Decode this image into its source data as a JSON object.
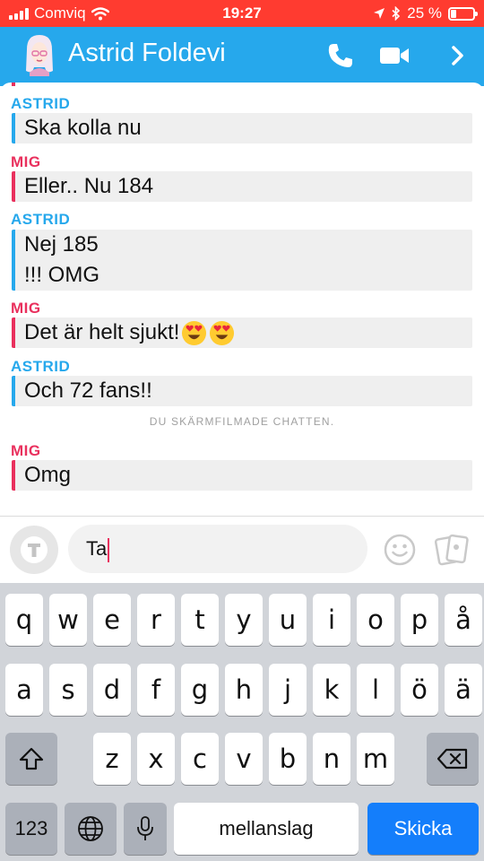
{
  "status_bar": {
    "carrier": "Comviq",
    "time": "19:27",
    "battery": "25 %",
    "battery_level": 0.25
  },
  "header": {
    "contact_name": "Astrid Foldevi"
  },
  "chat": {
    "blocks": [
      {
        "sender": "ASTRID",
        "lines": [
          "Ska kolla nu"
        ]
      },
      {
        "sender": "MIG",
        "lines": [
          "Eller.. Nu 184"
        ]
      },
      {
        "sender": "ASTRID",
        "lines": [
          "Nej 185",
          "!!! OMG"
        ]
      },
      {
        "sender": "MIG",
        "lines": [
          "Det är helt sjukt!"
        ]
      },
      {
        "sender": "ASTRID",
        "lines": [
          "Och 72 fans!!"
        ]
      },
      {
        "sender": "MIG",
        "lines": [
          "Omg"
        ]
      }
    ],
    "system_note": "DU SKÄRMFILMADE CHATTEN."
  },
  "input": {
    "text": "Ta"
  },
  "keyboard": {
    "row1": [
      "q",
      "w",
      "e",
      "r",
      "t",
      "y",
      "u",
      "i",
      "o",
      "p",
      "å"
    ],
    "row2": [
      "a",
      "s",
      "d",
      "f",
      "g",
      "h",
      "j",
      "k",
      "l",
      "ö",
      "ä"
    ],
    "row3": [
      "z",
      "x",
      "c",
      "v",
      "b",
      "n",
      "m"
    ],
    "numbers_label": "123",
    "space_label": "mellanslag",
    "send_label": "Skicka"
  },
  "colors": {
    "status_bar": "#ff3b30",
    "header": "#26a8ec",
    "astrid": "#26a8ec",
    "mig": "#e9305d",
    "send_key": "#147efb"
  },
  "icons": [
    "wifi-icon",
    "location-icon",
    "bluetooth-icon",
    "battery-icon",
    "phone-icon",
    "video-icon",
    "chevron-right-icon",
    "text-t-icon",
    "smiley-icon",
    "sticker-icon",
    "shift-icon",
    "backspace-icon",
    "globe-icon",
    "microphone-icon",
    "heart-eyes-emoji"
  ]
}
